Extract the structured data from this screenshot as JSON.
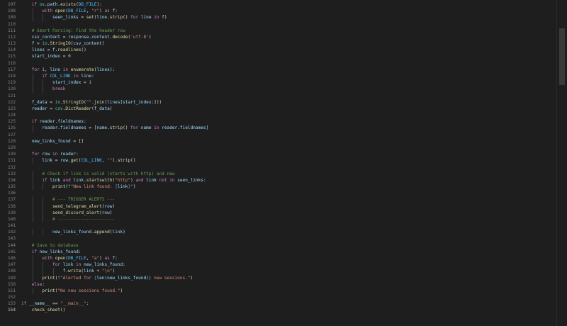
{
  "editor": {
    "language": "python",
    "active_line": 154,
    "lines": [
      {
        "n": "107",
        "t": "    if os.path.exists(DB_FILE):"
      },
      {
        "n": "108",
        "t": "        with open(DB_FILE, \"r\") as f:"
      },
      {
        "n": "109",
        "t": "            seen_links = set(line.strip() for line in f)"
      },
      {
        "n": "110",
        "t": ""
      },
      {
        "n": "111",
        "t": "    # Smart Parsing: Find the header row"
      },
      {
        "n": "112",
        "t": "    csv_content = response.content.decode('utf-8')"
      },
      {
        "n": "113",
        "t": "    f = io.StringIO(csv_content)"
      },
      {
        "n": "114",
        "t": "    lines = f.readlines()"
      },
      {
        "n": "115",
        "t": "    start_index = 0"
      },
      {
        "n": "116",
        "t": ""
      },
      {
        "n": "117",
        "t": "    for i, line in enumerate(lines):"
      },
      {
        "n": "118",
        "t": "        if COL_LINK in line:"
      },
      {
        "n": "119",
        "t": "            start_index = i"
      },
      {
        "n": "120",
        "t": "            break"
      },
      {
        "n": "121",
        "t": ""
      },
      {
        "n": "122",
        "t": "    f_data = io.StringIO(\"\".join(lines[start_index:]))"
      },
      {
        "n": "123",
        "t": "    reader = csv.DictReader(f_data)"
      },
      {
        "n": "124",
        "t": ""
      },
      {
        "n": "125",
        "t": "    if reader.fieldnames:"
      },
      {
        "n": "126",
        "t": "        reader.fieldnames = [name.strip() for name in reader.fieldnames]"
      },
      {
        "n": "127",
        "t": ""
      },
      {
        "n": "128",
        "t": "    new_links_found = []"
      },
      {
        "n": "129",
        "t": ""
      },
      {
        "n": "130",
        "t": "    for row in reader:"
      },
      {
        "n": "131",
        "t": "        link = row.get(COL_LINK, \"\").strip()"
      },
      {
        "n": "132",
        "t": ""
      },
      {
        "n": "133",
        "t": "        # Check if link is valid (starts with http) and new"
      },
      {
        "n": "134",
        "t": "        if link and link.startswith(\"http\") and link not in seen_links:"
      },
      {
        "n": "135",
        "t": "            print(f\"New link found: {link}\")"
      },
      {
        "n": "136",
        "t": ""
      },
      {
        "n": "137",
        "t": "            # --- TRIGGER ALERTS ---"
      },
      {
        "n": "138",
        "t": "            send_telegram_alert(row)"
      },
      {
        "n": "139",
        "t": "            send_discord_alert(row)"
      },
      {
        "n": "140",
        "t": "            # ----------------------"
      },
      {
        "n": "141",
        "t": ""
      },
      {
        "n": "142",
        "t": "            new_links_found.append(link)"
      },
      {
        "n": "143",
        "t": ""
      },
      {
        "n": "144",
        "t": "    # Save to database"
      },
      {
        "n": "145",
        "t": "    if new_links_found:"
      },
      {
        "n": "146",
        "t": "        with open(DB_FILE, \"a\") as f:"
      },
      {
        "n": "147",
        "t": "            for link in new_links_found:"
      },
      {
        "n": "148",
        "t": "                f.write(link + \"\\n\")"
      },
      {
        "n": "149",
        "t": "        print(f\"Alerted for {len(new_links_found)} new sessions.\")"
      },
      {
        "n": "150",
        "t": "    else:"
      },
      {
        "n": "151",
        "t": "        print(\"No new sessions found.\")"
      },
      {
        "n": "152",
        "t": ""
      },
      {
        "n": "153",
        "t": "if __name__ == \"__main__\":"
      },
      {
        "n": "154",
        "t": "    check_sheet()"
      }
    ]
  },
  "colors": {
    "background": "#1e1e1e",
    "keyword": "#c586c0",
    "string": "#ce9178",
    "comment": "#6a9955",
    "function": "#dcdcaa",
    "variable": "#9cdcfe"
  }
}
